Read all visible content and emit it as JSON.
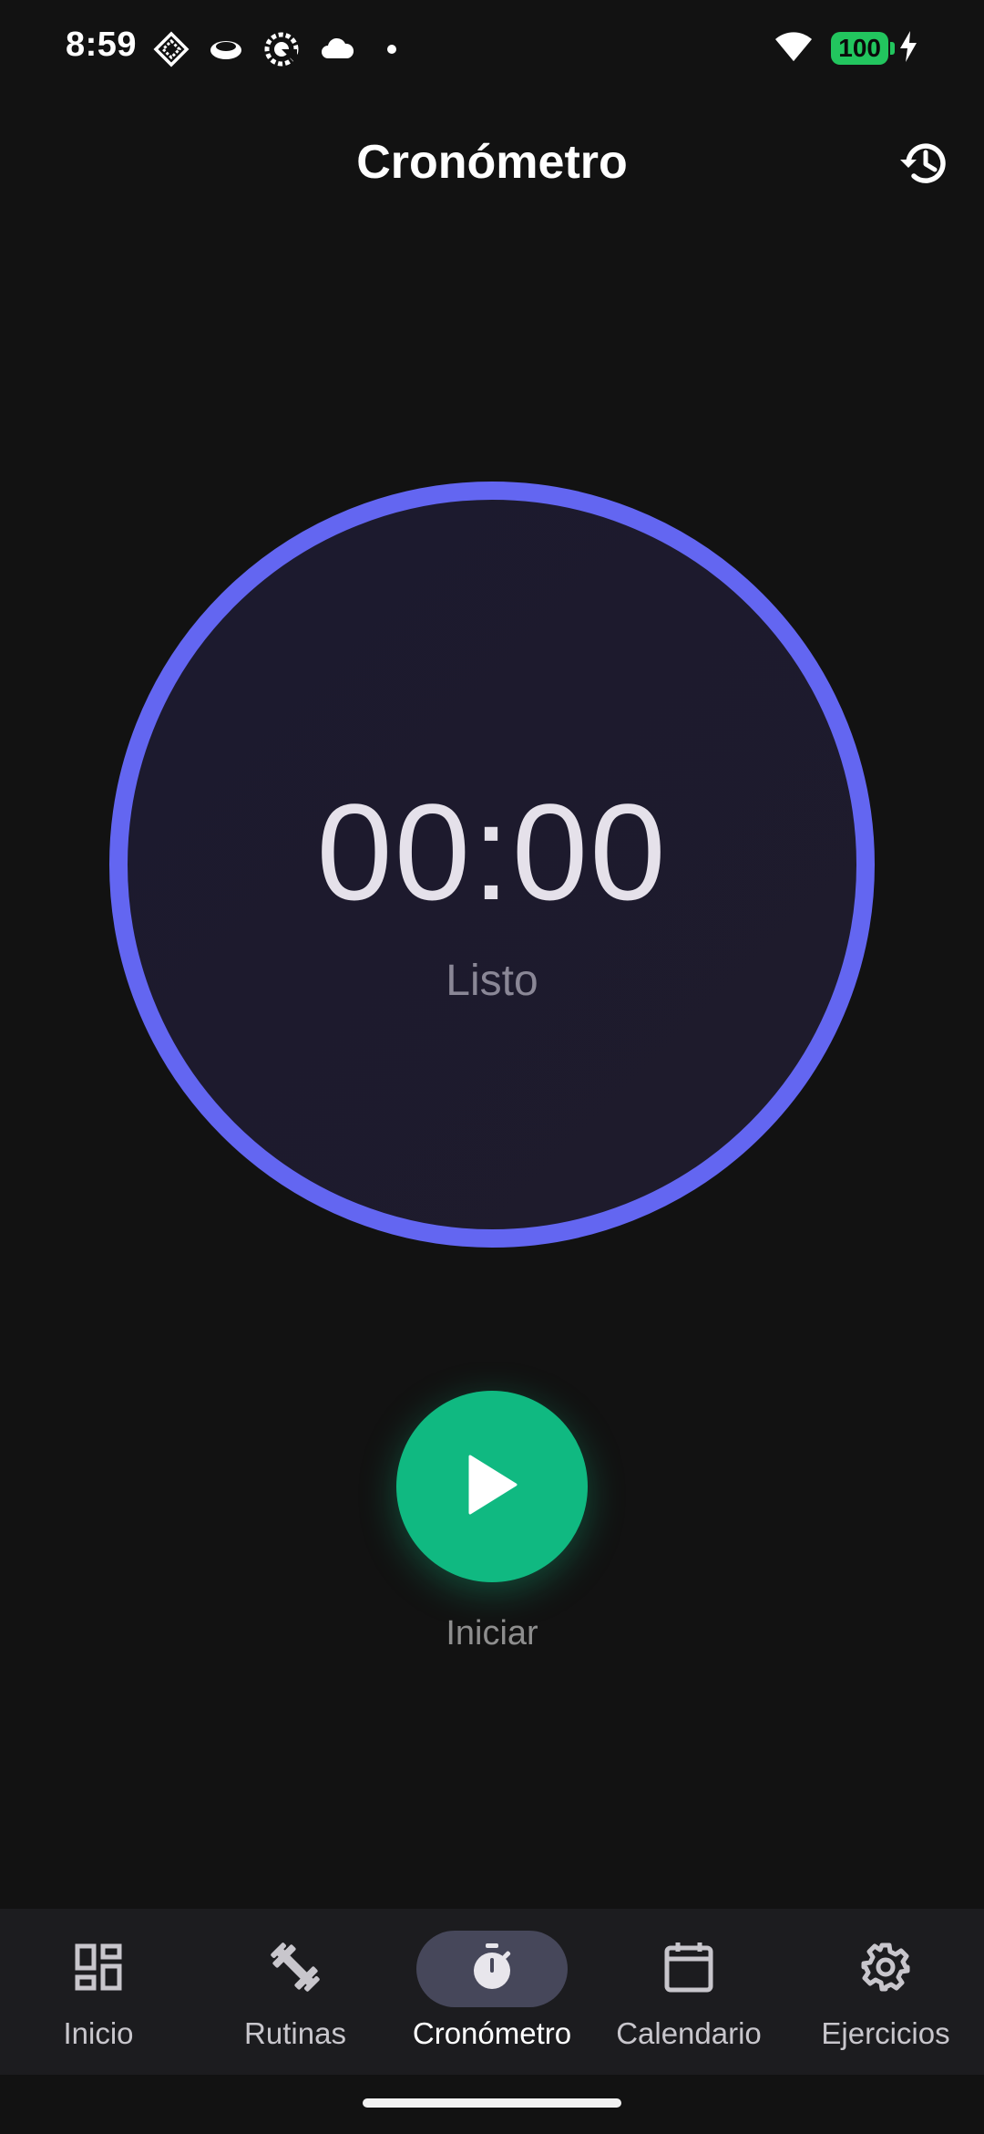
{
  "status_bar": {
    "time": "8:59",
    "battery": "100",
    "icons": [
      "diamond-app-icon",
      "cloud-app-icon",
      "settings-app-icon",
      "cloud-icon",
      "dot-icon",
      "wifi-icon",
      "battery-icon",
      "charging-icon"
    ]
  },
  "app_bar": {
    "title": "Cronómetro",
    "history_icon": "history-icon"
  },
  "timer": {
    "value": "00:00",
    "status": "Listo",
    "ring_color": "#6366f1"
  },
  "start": {
    "label": "Iniciar",
    "icon": "play-icon",
    "color": "#10b981"
  },
  "nav": {
    "items": [
      {
        "label": "Inicio",
        "icon": "dashboard-icon",
        "active": false
      },
      {
        "label": "Rutinas",
        "icon": "dumbbell-icon",
        "active": false
      },
      {
        "label": "Cronómetro",
        "icon": "stopwatch-icon",
        "active": true
      },
      {
        "label": "Calendario",
        "icon": "calendar-icon",
        "active": false
      },
      {
        "label": "Ejercicios",
        "icon": "gear-icon",
        "active": false
      }
    ]
  }
}
